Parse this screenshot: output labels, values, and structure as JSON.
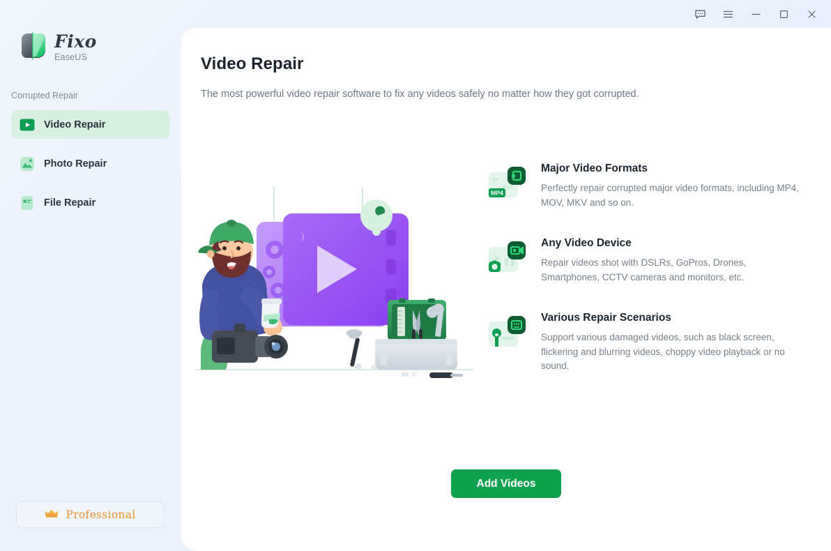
{
  "window": {
    "controls": [
      {
        "name": "feedback-icon",
        "label": "Feedback"
      },
      {
        "name": "menu-icon",
        "label": "Menu"
      },
      {
        "name": "minimize-icon",
        "label": "Minimize"
      },
      {
        "name": "maximize-icon",
        "label": "Maximize"
      },
      {
        "name": "close-icon",
        "label": "Close"
      }
    ]
  },
  "sidebar": {
    "brand": {
      "name": "Fixo",
      "sub": "EaseUS",
      "logo_icon": "fixo-logo-icon"
    },
    "section_label": "Corrupted Repair",
    "items": [
      {
        "label": "Video Repair",
        "icon": "video-play-icon",
        "active": true
      },
      {
        "label": "Photo Repair",
        "icon": "photo-image-icon",
        "active": false
      },
      {
        "label": "File Repair",
        "icon": "file-document-icon",
        "active": false
      }
    ],
    "pro_button": {
      "label": "Professional",
      "icon": "crown-icon"
    }
  },
  "main": {
    "title": "Video Repair",
    "subtitle": "The most powerful video repair software to fix any videos safely no matter how they got corrupted.",
    "illustration": {
      "name": "video-repair-illustration",
      "elements": [
        "cameraman",
        "coffee-cup",
        "video-player-panel",
        "play-button",
        "toolbox",
        "wrench-badge",
        "camera"
      ]
    },
    "features": [
      {
        "title": "Major Video Formats",
        "desc": "Perfectly repair corrupted major video formats, including MP4, MOV, MKV and so on.",
        "icon": "video-formats-icon",
        "badges": [
          "MP4",
          "AVI"
        ]
      },
      {
        "title": "Any Video Device",
        "desc": "Repair videos shot with DSLRs, GoPros, Drones, Smartphones, CCTV cameras and monitors, etc.",
        "icon": "video-device-icon",
        "badges": []
      },
      {
        "title": "Various Repair Scenarios",
        "desc": "Support various damaged videos, such as black screen, flickering and blurring videos, choppy video playback or no sound.",
        "icon": "repair-scenarios-icon",
        "badges": []
      }
    ],
    "add_button": {
      "label": "Add Videos"
    }
  },
  "colors": {
    "accent_green": "#0ea24f",
    "dark_green": "#0b6b35",
    "active_bg": "#d9f0e2",
    "pro_orange": "#e8912e",
    "panel_white": "#ffffff",
    "sidebar_blue": "#eaf1fb",
    "purple": "#9152f0"
  }
}
